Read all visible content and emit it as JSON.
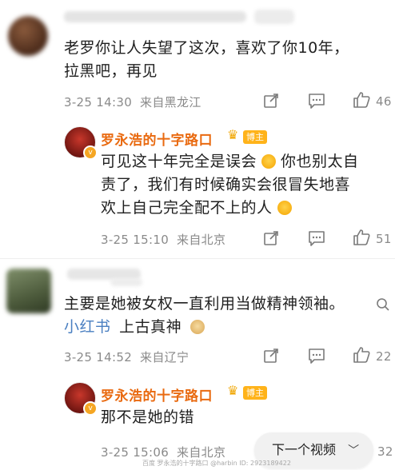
{
  "comments": [
    {
      "text_line1": "老罗你让人失望了这次，喜欢了你10年，",
      "text_line2": "拉黑吧，再见",
      "date": "3-25 14:30",
      "location": "来自黑龙江",
      "like_count": "46"
    },
    {
      "author": "罗永浩的十字路口",
      "badge": "博主",
      "text_line1": "可见这十年完全是误会",
      "text_line1b": "你也别太自",
      "text_line2": "责了，我们有时候确实会很冒失地喜",
      "text_line3": "欢上自己完全配不上的人",
      "date": "3-25 15:10",
      "location": "来自北京",
      "like_count": "51"
    },
    {
      "text_line1": "主要是她被女权一直利用当做精神领袖。",
      "link": "小红书",
      "text_line2": "上古真神",
      "date": "3-25 14:52",
      "location": "来自辽宁",
      "like_count": "22"
    },
    {
      "author": "罗永浩的十字路口",
      "badge": "博主",
      "text_line1": "那不是她的错",
      "date": "3-25 15:06",
      "location": "来自北京",
      "like_count": "32"
    }
  ],
  "next_video_label": "下一个视频",
  "watermark": "百度 罗永浩的十字路口 @harbin ID: 2923189422",
  "icons": [
    "share-icon",
    "comment-icon",
    "like-icon",
    "search-icon",
    "crown-icon",
    "chevron-down-icon"
  ],
  "colors": {
    "blogger_name": "#e96a10",
    "badge": "#ffb31a",
    "link": "#4a7fc1",
    "meta": "#8a8a8a"
  }
}
